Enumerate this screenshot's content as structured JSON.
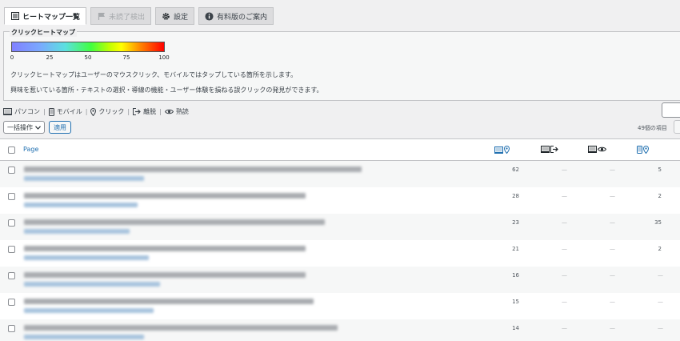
{
  "tabs": [
    {
      "label": "ヒートマップ一覧",
      "icon": "list-icon",
      "state": "active"
    },
    {
      "label": "未読了検出",
      "icon": "flag-icon",
      "state": "disabled"
    },
    {
      "label": "設定",
      "icon": "gear-icon",
      "state": "normal"
    },
    {
      "label": "有料版のご案内",
      "icon": "info-icon",
      "state": "normal"
    }
  ],
  "legend": {
    "title": "クリックヒートマップ",
    "ticks": [
      "0",
      "25",
      "50",
      "75",
      "100"
    ],
    "desc1": "クリックヒートマップはユーザーのマウスクリック、モバイルではタップしている箇所を示します。",
    "desc2": "興味を惹いている箇所・テキストの選択・導線の機能・ユーザー体験を損ねる誤クリックの発見ができます。"
  },
  "filters": [
    {
      "label": "パソコン",
      "icon": "desktop-icon"
    },
    {
      "label": "モバイル",
      "icon": "mobile-icon"
    },
    {
      "label": "クリック",
      "icon": "location-icon"
    },
    {
      "label": "離脱",
      "icon": "exit-icon"
    },
    {
      "label": "熟読",
      "icon": "eye-icon"
    }
  ],
  "bulk": {
    "select_label": "一括操作",
    "apply_label": "適用"
  },
  "items_count": "49個の項目",
  "table": {
    "page_header": "Page",
    "rows": [
      {
        "c1": "62",
        "c2": "—",
        "c3": "—",
        "c4": "5"
      },
      {
        "c1": "28",
        "c2": "—",
        "c3": "—",
        "c4": "2"
      },
      {
        "c1": "23",
        "c2": "—",
        "c3": "—",
        "c4": "35"
      },
      {
        "c1": "21",
        "c2": "—",
        "c3": "—",
        "c4": "2"
      },
      {
        "c1": "16",
        "c2": "—",
        "c3": "—",
        "c4": "—"
      },
      {
        "c1": "15",
        "c2": "—",
        "c3": "—",
        "c4": "—"
      },
      {
        "c1": "14",
        "c2": "—",
        "c3": "—",
        "c4": "—"
      }
    ]
  },
  "colors": {
    "accent": "#2271b1",
    "border": "#c3c4c7",
    "background": "#f0f0f1"
  }
}
